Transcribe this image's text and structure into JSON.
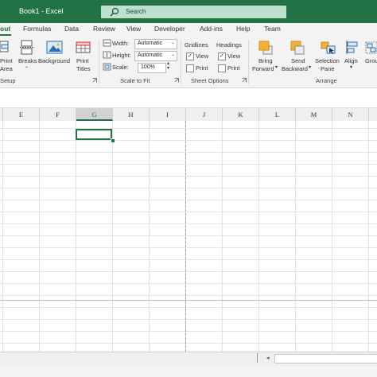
{
  "window": {
    "title": "Book1  -  Excel"
  },
  "search": {
    "label": "Search"
  },
  "tabs": [
    {
      "label": "out",
      "active": true
    },
    {
      "label": "Formulas"
    },
    {
      "label": "Data"
    },
    {
      "label": "Review"
    },
    {
      "label": "View"
    },
    {
      "label": "Developer"
    },
    {
      "label": "Add-ins"
    },
    {
      "label": "Help"
    },
    {
      "label": "Team"
    }
  ],
  "ribbon": {
    "page_setup": {
      "print_area": [
        "Print",
        "Area"
      ],
      "breaks": "Breaks",
      "background": "Background",
      "print_titles": [
        "Print",
        "Titles"
      ],
      "group_label": "Setup"
    },
    "scale_to_fit": {
      "width_label": "Width:",
      "width_value": "Automatic",
      "height_label": "Height:",
      "height_value": "Automatic",
      "scale_label": "Scale:",
      "scale_value": "100%",
      "group_label": "Scale to Fit"
    },
    "sheet_options": {
      "gridlines_label": "Gridlines",
      "headings_label": "Headings",
      "view_label": "View",
      "print_label": "Print",
      "gridlines_view": true,
      "gridlines_print": false,
      "headings_view": true,
      "headings_print": false,
      "group_label": "Sheet Options"
    },
    "arrange": {
      "bring_forward": [
        "Bring",
        "Forward"
      ],
      "send_backward": [
        "Send",
        "Backward"
      ],
      "selection_pane": [
        "Selection",
        "Pane"
      ],
      "align": "Align",
      "group": "Grou",
      "group_label": "Arrange"
    }
  },
  "sheet": {
    "columns": [
      "E",
      "F",
      "G",
      "H",
      "I",
      "J",
      "K",
      "L",
      "M",
      "N"
    ],
    "selected_column": "G"
  },
  "colors": {
    "brand": "#217346",
    "search_bg": "#bfe0cc",
    "ribbon_bg": "#f3f3f3"
  }
}
